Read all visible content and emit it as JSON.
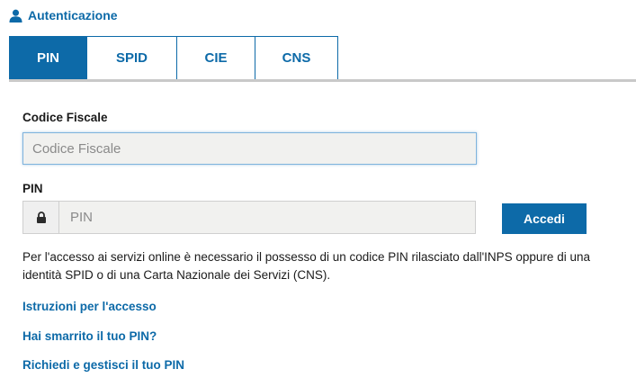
{
  "header": {
    "icon": "user-icon",
    "title": "Autenticazione"
  },
  "tabs": [
    {
      "label": "PIN",
      "active": true
    },
    {
      "label": "SPID",
      "active": false
    },
    {
      "label": "CIE",
      "active": false
    },
    {
      "label": "CNS",
      "active": false
    }
  ],
  "form": {
    "codice_fiscale": {
      "label": "Codice Fiscale",
      "placeholder": "Codice Fiscale",
      "value": ""
    },
    "pin": {
      "label": "PIN",
      "placeholder": "PIN",
      "value": "",
      "icon": "lock-icon"
    },
    "submit_label": "Accedi"
  },
  "info_text": "Per l'accesso ai servizi online è necessario il possesso di un codice PIN rilasciato dall'INPS oppure di una identità SPID o di una Carta Nazionale dei Servizi (CNS).",
  "links": [
    "Istruzioni per l'accesso",
    "Hai smarrito il tuo PIN?",
    "Richiedi e gestisci il tuo PIN"
  ],
  "colors": {
    "accent": "#0d6aa8",
    "input_background": "#f1f1ef",
    "divider": "#c9c9c9"
  }
}
